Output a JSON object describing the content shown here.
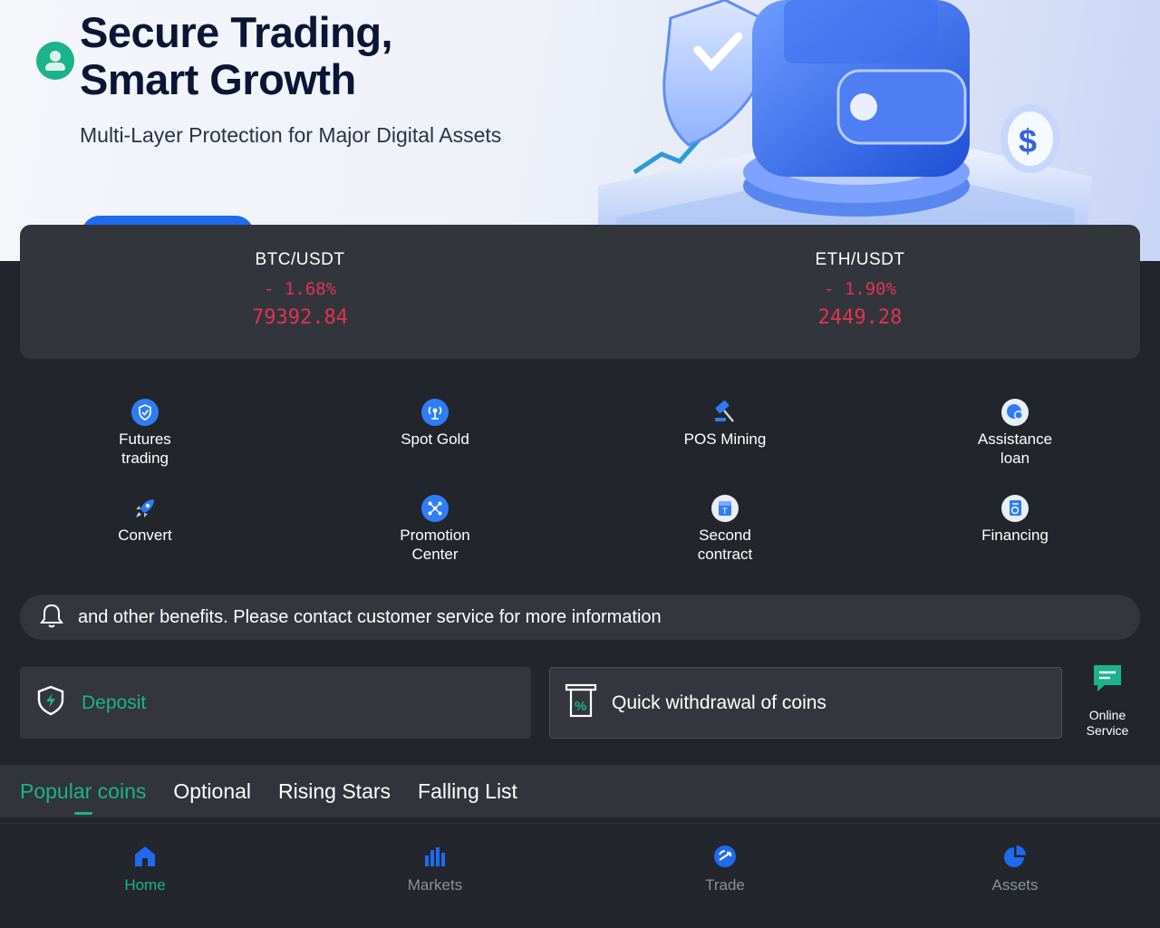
{
  "banner": {
    "title_line1": "Secure Trading,",
    "title_line2": "Smart Growth",
    "subtitle": "Multi-Layer Protection for Major Digital Assets"
  },
  "ticker": [
    {
      "pair": "BTC/USDT",
      "change": "- 1.68%",
      "price": "79392.84"
    },
    {
      "pair": "ETH/USDT",
      "change": "- 1.90%",
      "price": "2449.28"
    }
  ],
  "features": [
    {
      "label": "Futures trading",
      "icon": "shield-check-icon"
    },
    {
      "label": "Spot Gold",
      "icon": "broadcast-icon"
    },
    {
      "label": "POS Mining",
      "icon": "hammer-icon"
    },
    {
      "label": "Assistance loan",
      "icon": "coin-icon"
    },
    {
      "label": "Convert",
      "icon": "rocket-icon"
    },
    {
      "label": "Promotion Center",
      "icon": "network-icon"
    },
    {
      "label": "Second contract",
      "icon": "contract-icon"
    },
    {
      "label": "Financing",
      "icon": "finance-doc-icon"
    }
  ],
  "notice": {
    "text": "and other benefits. Please contact customer service for more information",
    "icon": "bell-icon"
  },
  "actions": {
    "deposit": "Deposit",
    "withdraw": "Quick withdrawal of coins",
    "service": "Online Service"
  },
  "tabs": [
    "Popular coins",
    "Optional",
    "Rising Stars",
    "Falling List"
  ],
  "bottom_nav": [
    {
      "label": "Home",
      "icon": "home-icon"
    },
    {
      "label": "Markets",
      "icon": "bar-chart-icon"
    },
    {
      "label": "Trade",
      "icon": "trade-icon"
    },
    {
      "label": "Assets",
      "icon": "pie-chart-icon"
    }
  ],
  "colors": {
    "accent": "#1bb38b",
    "negative": "#e0344e",
    "primary_blue": "#1e6bf0",
    "background": "#22262c",
    "card": "#32363c"
  }
}
